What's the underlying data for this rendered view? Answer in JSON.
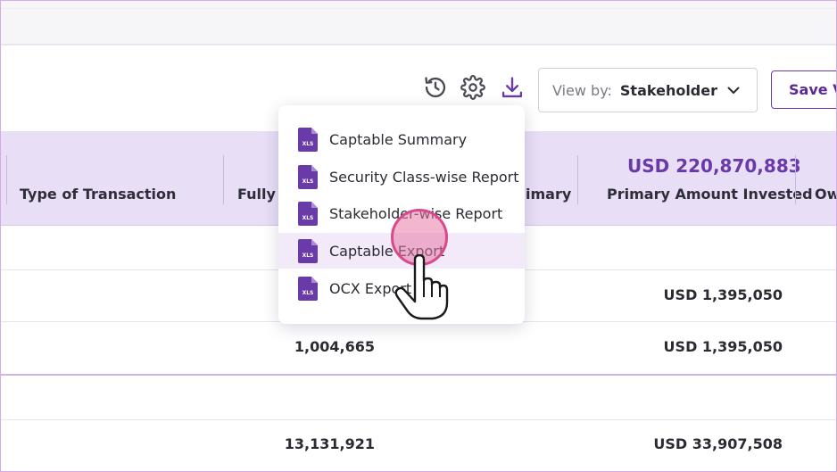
{
  "toolbar": {
    "icons": [
      "history-icon",
      "gear-icon",
      "download-icon"
    ],
    "view_by_label": "View by:",
    "view_by_value": "Stakeholder",
    "save_view_label": "Save Vi"
  },
  "table": {
    "headers": {
      "type_of_transaction": "Type of Transaction",
      "fully_partial": "Fully I",
      "fully_top_partial": "",
      "primary_partial": "imary",
      "primary_amount_total": "USD 220,870,883",
      "primary_amount_invested": "Primary Amount Invested",
      "ownership_partial": "Ow"
    },
    "rows": [
      {
        "fully": "",
        "amount": "USD 1,395,050"
      },
      {
        "fully": "1,004,665",
        "amount": "USD 1,395,050"
      },
      {
        "fully": "",
        "amount": ""
      },
      {
        "fully": "13,131,921",
        "amount": "USD 33,907,508"
      }
    ]
  },
  "download_menu": {
    "items": [
      {
        "label": "Captable Summary",
        "icon": "xls-file-icon"
      },
      {
        "label": "Security Class-wise Report",
        "icon": "xls-file-icon"
      },
      {
        "label": "Stakeholder-wise Report",
        "icon": "xls-file-icon"
      },
      {
        "label": "Captable Export",
        "icon": "xls-file-icon",
        "highlighted": true
      },
      {
        "label": "OCX Export",
        "icon": "xls-file-icon"
      }
    ],
    "icon_badge_text": "XLS"
  },
  "colors": {
    "accent": "#6a3aa8",
    "header_band": "#e8def6",
    "menu_highlight": "#f2eaf9",
    "click_ring": "#d94a8c"
  }
}
